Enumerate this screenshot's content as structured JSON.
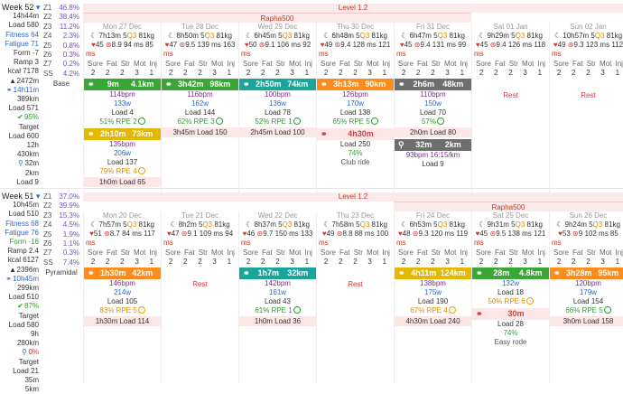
{
  "weeks": [
    {
      "title": "Week 52",
      "summary": {
        "time": "14h44m",
        "load": "Load 580",
        "fitness": "Fitness 64",
        "fatigue": "Fatigue 71",
        "form": "Form -7",
        "ramp": "Ramp 3",
        "kcal": "kcal 7178",
        "elev": "2472m",
        "bike_time": "14h11m",
        "bike_dist": "389km",
        "bike_load": "Load 571",
        "pct": "95%",
        "target": "Target",
        "target_load": "Load 600",
        "target_time": "12h",
        "target_dist": "430km",
        "run_time": "32m",
        "run_dist": "2km",
        "run_load": "Load 9"
      },
      "zones": [
        [
          "Z1",
          "46.8%"
        ],
        [
          "Z2",
          "38.4%"
        ],
        [
          "Z3",
          "11.2%"
        ],
        [
          "Z4",
          "2.3%"
        ],
        [
          "Z5",
          "0.8%"
        ],
        [
          "Z6",
          "0.3%"
        ],
        [
          "Z7",
          "0.2%"
        ],
        [
          "SS",
          "4.2%"
        ]
      ],
      "zone_mode": "Base",
      "plan_top": "Level 1.2",
      "plan_sub": "Rapha500",
      "days": [
        {
          "date": "Mon 27 Dec",
          "m1": "7h13m 5",
          "q": "Q3",
          "w": "81kg",
          "hr": "45",
          "hrv": "8.9",
          "m2": "94 ms 85",
          "m3": "ms",
          "sl": [
            "Sore",
            "Fat",
            "Str",
            "Mot",
            "Inj"
          ],
          "sv": [
            "2",
            "2",
            "2",
            "3",
            "1"
          ],
          "acts": [
            {
              "cls": "green",
              "a": "9m",
              "b": "4.1km",
              "lines": [
                [
                  "pur",
                  "114bpm"
                ],
                [
                  "blu",
                  "133w"
                ],
                [
                  "",
                  "Load 4"
                ],
                [
                  "grn",
                  "51% RPE 2"
                ]
              ],
              "box": ""
            },
            {
              "cls": "yellow",
              "a": "2h10m",
              "b": "73km",
              "lines": [
                [
                  "pur",
                  "135bpm"
                ],
                [
                  "blu",
                  "206w"
                ],
                [
                  "",
                  "Load 137"
                ],
                [
                  "org",
                  "79% RPE 4"
                ]
              ],
              "box": "1h0m Load 65"
            }
          ]
        },
        {
          "date": "Tue 28 Dec",
          "m1": "8h50m 5",
          "q": "Q3",
          "w": "81kg",
          "hr": "47",
          "hrv": "9.5",
          "m2": "139 ms 163",
          "m3": "ms",
          "sl": [
            "Sore",
            "Fat",
            "Str",
            "Mot",
            "Inj"
          ],
          "sv": [
            "2",
            "2",
            "2",
            "3",
            "1"
          ],
          "acts": [
            {
              "cls": "green",
              "a": "3h42m",
              "b": "98km",
              "lines": [
                [
                  "pur",
                  "116bpm"
                ],
                [
                  "blu",
                  "162w"
                ],
                [
                  "",
                  "Load 144"
                ],
                [
                  "grn",
                  "62% RPE 3"
                ]
              ],
              "box": "3h45m Load 150"
            }
          ]
        },
        {
          "date": "Wed 29 Dec",
          "m1": "6h45m 5",
          "q": "Q3",
          "w": "81kg",
          "hr": "50",
          "hrv": "9.1",
          "m2": "106 ms 92",
          "m3": "ms",
          "sl": [
            "Sore",
            "Fat",
            "Str",
            "Mot",
            "Inj"
          ],
          "sv": [
            "2",
            "2",
            "2",
            "3",
            "1"
          ],
          "acts": [
            {
              "cls": "teal",
              "a": "2h50m",
              "b": "74km",
              "lines": [
                [
                  "pur",
                  "100bpm"
                ],
                [
                  "blu",
                  "136w"
                ],
                [
                  "",
                  "Load 78"
                ],
                [
                  "grn",
                  "52% RPE 1"
                ]
              ],
              "box": "2h45m Load 100"
            }
          ]
        },
        {
          "date": "Thu 30 Dec",
          "m1": "6h48m 5",
          "q": "Q3",
          "w": "81kg",
          "hr": "49",
          "hrv": "9.4",
          "m2": "128 ms 121",
          "m3": "ms",
          "sl": [
            "Sore",
            "Fat",
            "Str",
            "Mot",
            "Inj"
          ],
          "sv": [
            "2",
            "2",
            "2",
            "3",
            "1"
          ],
          "acts": [
            {
              "cls": "orange",
              "a": "3h13m",
              "b": "90km",
              "lines": [
                [
                  "pur",
                  "126bpm"
                ],
                [
                  "blu",
                  "170w"
                ],
                [
                  "",
                  "Load 138"
                ],
                [
                  "grn",
                  "65% RPE 5"
                ]
              ],
              "box": ""
            }
          ],
          "planned": {
            "a": "4h30m",
            "load": "Load 250",
            "pct": "74%",
            "note": "Club ride"
          }
        },
        {
          "date": "Fri 31 Dec",
          "m1": "6h47m 5",
          "q": "Q3",
          "w": "81kg",
          "hr": "45",
          "hrv": "9.4",
          "m2": "131 ms 99",
          "m3": "ms",
          "sl": [
            "Sore",
            "Fat",
            "Str",
            "Mot",
            "Inj"
          ],
          "sv": [
            "2",
            "2",
            "2",
            "3",
            "1"
          ],
          "acts": [
            {
              "cls": "gray",
              "a": "2h6m",
              "b": "48km",
              "lines": [
                [
                  "pur",
                  "110bpm"
                ],
                [
                  "blu",
                  "150w"
                ],
                [
                  "",
                  "Load 70"
                ],
                [
                  "grn",
                  "57%"
                ]
              ],
              "box": "2h0m Load 80"
            }
          ],
          "run": {
            "a": "32m",
            "b": "2km",
            "pace": "93bpm 16:15/km",
            "load": "Load 9"
          }
        },
        {
          "date": "Sat 01 Jan",
          "m1": "9h29m 5",
          "q": "Q3",
          "w": "81kg",
          "hr": "45",
          "hrv": "9.4",
          "m2": "126 ms 118",
          "m3": "ms",
          "sl": [
            "Sore",
            "Fat",
            "Str",
            "Mot",
            "Inj"
          ],
          "sv": [
            "2",
            "2",
            "2",
            "3",
            "1"
          ],
          "rest": "Rest",
          "acts": []
        },
        {
          "date": "Sun 02 Jan",
          "m1": "10h57m 5",
          "q": "Q3",
          "w": "81kg",
          "hr": "49",
          "hrv": "9.3",
          "m2": "123 ms 112",
          "m3": "ms",
          "sl": [
            "Sore",
            "Fat",
            "Str",
            "Mot",
            "Inj"
          ],
          "sv": [
            "2",
            "2",
            "2",
            "3",
            "1"
          ],
          "rest": "Rest",
          "acts": []
        }
      ]
    },
    {
      "title": "Week 51",
      "summary": {
        "time": "10h45m",
        "load": "Load 510",
        "fitness": "Fitness 68",
        "fatigue": "Fatigue 76",
        "form": "Form -16",
        "ramp": "Ramp 2.4",
        "kcal": "kcal 6127",
        "elev": "2396m",
        "bike_time": "10h45m",
        "bike_dist": "299km",
        "bike_load": "Load 510",
        "pct": "87%",
        "target": "Target",
        "target_load": "Load 580",
        "target_time": "9h",
        "target_dist": "280km",
        "run_pct": "0%",
        "run_target": "Target",
        "run_load": "Load 21",
        "run_dist": "35m",
        "run_km": "5km"
      },
      "zones": [
        [
          "Z1",
          "37.0%"
        ],
        [
          "Z2",
          "39.9%"
        ],
        [
          "Z3",
          "15.3%"
        ],
        [
          "Z4",
          "4.5%"
        ],
        [
          "Z5",
          "1.9%"
        ],
        [
          "Z6",
          "1.1%"
        ],
        [
          "Z7",
          "0.3%"
        ],
        [
          "SS",
          "7.4%"
        ]
      ],
      "zone_mode": "Pyramidal",
      "plan_top": "Level 1.2",
      "plan_sub": "Rapha500",
      "days": [
        {
          "date": "Mon 20 Dec",
          "m1": "7h57m 5",
          "q": "Q3",
          "w": "81kg",
          "hr": "51",
          "hrv": "8.7",
          "m2": "84 ms 117",
          "m3": "ms",
          "sl": [
            "Sore",
            "Fat",
            "Str",
            "Mot",
            "Inj"
          ],
          "sv": [
            "2",
            "2",
            "2",
            "3",
            "1"
          ],
          "acts": [
            {
              "cls": "orange",
              "a": "1h30m",
              "b": "42km",
              "lines": [
                [
                  "pur",
                  "146bpm"
                ],
                [
                  "blu",
                  "214w"
                ],
                [
                  "",
                  "Load 105"
                ],
                [
                  "org",
                  "83% RPE 5"
                ]
              ],
              "box": "1h30m Load 114"
            }
          ]
        },
        {
          "date": "Tue 21 Dec",
          "m1": "8h2m 5",
          "q": "Q3",
          "w": "81kg",
          "hr": "47",
          "hrv": "9.1",
          "m2": "109 ms 94",
          "m3": "ms",
          "sl": [
            "Sore",
            "Fat",
            "Str",
            "Mot",
            "Inj"
          ],
          "sv": [
            "2",
            "2",
            "2",
            "3",
            "1"
          ],
          "rest": "Rest",
          "acts": []
        },
        {
          "date": "Wed 22 Dec",
          "m1": "8h37m 5",
          "q": "Q3",
          "w": "81kg",
          "hr": "46",
          "hrv": "9.7",
          "m2": "150 ms 133",
          "m3": "ms",
          "sl": [
            "Sore",
            "Fat",
            "Str",
            "Mot",
            "Inj"
          ],
          "sv": [
            "2",
            "2",
            "2",
            "3",
            "1"
          ],
          "acts": [
            {
              "cls": "teal",
              "a": "1h7m",
              "b": "32km",
              "lines": [
                [
                  "pur",
                  "142bpm"
                ],
                [
                  "blu",
                  "161w"
                ],
                [
                  "",
                  "Load 43"
                ],
                [
                  "grn",
                  "61% RPE 1"
                ]
              ],
              "box": "1h0m Load 36"
            }
          ]
        },
        {
          "date": "Thu 23 Dec",
          "m1": "7h58m 5",
          "q": "Q3",
          "w": "81kg",
          "hr": "49",
          "hrv": "8.8",
          "m2": "88 ms 100",
          "m3": "ms",
          "sl": [
            "Sore",
            "Fat",
            "Str",
            "Mot",
            "Inj"
          ],
          "sv": [
            "2",
            "2",
            "2",
            "3",
            "1"
          ],
          "rest": "Rest",
          "acts": []
        },
        {
          "date": "Fri 24 Dec",
          "m1": "6h53m 5",
          "q": "Q3",
          "w": "81kg",
          "hr": "48",
          "hrv": "9.3",
          "m2": "120 ms 119",
          "m3": "ms",
          "sl": [
            "Sore",
            "Fat",
            "Str",
            "Mot",
            "Inj"
          ],
          "sv": [
            "2",
            "2",
            "2",
            "3",
            "1"
          ],
          "acts": [
            {
              "cls": "yellow",
              "a": "4h11m",
              "b": "124km",
              "lines": [
                [
                  "pur",
                  "138bpm"
                ],
                [
                  "blu",
                  "175w"
                ],
                [
                  "",
                  "Load 190"
                ],
                [
                  "org",
                  "67% RPE 4"
                ]
              ],
              "box": "4h30m Load 240"
            }
          ]
        },
        {
          "date": "Sat 25 Dec",
          "m1": "9h31m 5",
          "q": "Q3",
          "w": "81kg",
          "hr": "45",
          "hrv": "9.5",
          "m2": "138 ms 121",
          "m3": "ms",
          "sl": [
            "Sore",
            "Fat",
            "Str",
            "Mot",
            "Inj"
          ],
          "sv": [
            "2",
            "2",
            "2",
            "3",
            "1"
          ],
          "acts": [
            {
              "cls": "green",
              "a": "28m",
              "b": "4.8km",
              "lines": [
                [
                  "blu",
                  "132w"
                ],
                [
                  "",
                  "Load 18"
                ],
                [
                  "org",
                  "50% RPE 6"
                ]
              ],
              "box": ""
            }
          ],
          "planned": {
            "a": "30m",
            "load": "Load 28",
            "pct": "74%",
            "note": "Easy rode"
          }
        },
        {
          "date": "Sun 26 Dec",
          "m1": "9h24m 5",
          "q": "Q3",
          "w": "81kg",
          "hr": "53",
          "hrv": "9",
          "m2": "102 ms 85",
          "m3": "ms",
          "sl": [
            "Sore",
            "Fat",
            "Str",
            "Mot",
            "Inj"
          ],
          "sv": [
            "2",
            "2",
            "2",
            "3",
            "1"
          ],
          "acts": [
            {
              "cls": "orange",
              "a": "3h28m",
              "b": "95km",
              "lines": [
                [
                  "pur",
                  "120bpm"
                ],
                [
                  "blu",
                  "179w"
                ],
                [
                  "",
                  "Load 154"
                ],
                [
                  "grn",
                  "66% RPE 5"
                ]
              ],
              "box": "3h0m Load 158"
            }
          ]
        }
      ]
    }
  ],
  "icons": {
    "bike": "bike-icon",
    "run": "run-icon",
    "moon": "moon-icon",
    "heart": "heart-icon",
    "check": "check-icon"
  }
}
